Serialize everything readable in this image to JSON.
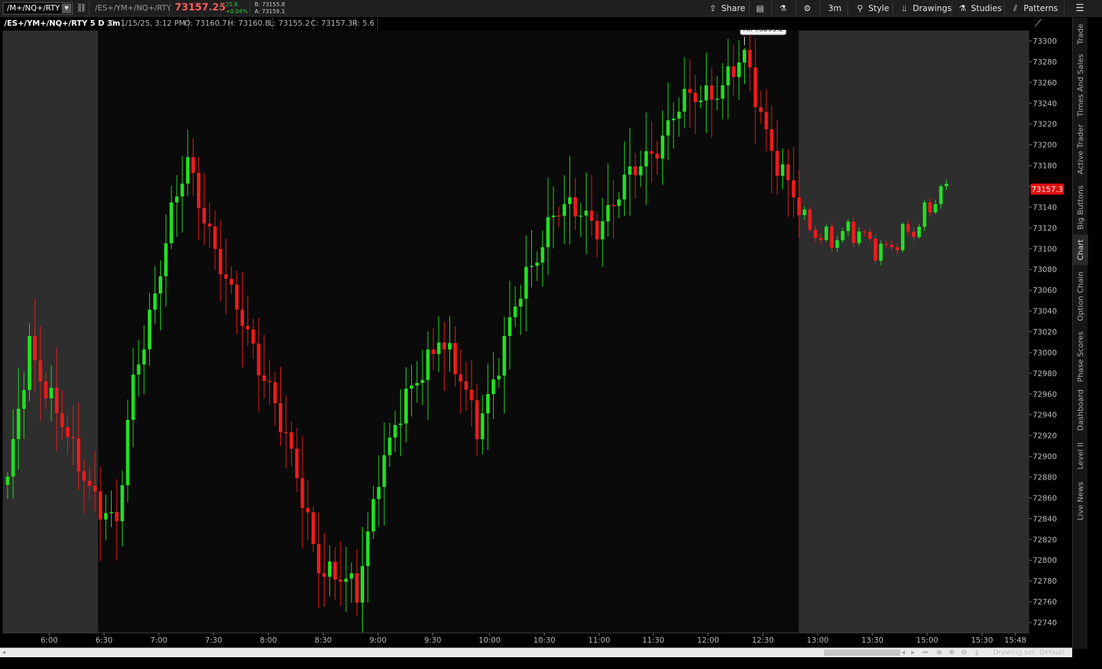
{
  "toolbar": {
    "symbol_input": "/M+/NQ+/RTY",
    "full_symbol": "/ES+/YM+/NQ+/RTY",
    "last_price": "73157.25",
    "net_change": "25.8",
    "percent_change": "+0.04%",
    "bid": "B: 73155.8",
    "ask": "A: 73159.1",
    "share_label": "Share",
    "timeframe_label": "3m",
    "style_label": "Style",
    "drawings_label": "Drawings",
    "studies_label": "Studies",
    "patterns_label": "Patterns"
  },
  "info_bar": {
    "title": "/ES+/YM+/NQ+/RTY 5 D 3m",
    "date": "D: 1/15/25, 3:12 PM",
    "open": "O: 73160.7",
    "high": "H: 73160.8",
    "low": "L: 73155.2",
    "close": "C: 73157.3",
    "range": "R: 5.6"
  },
  "sidebar": {
    "tabs": [
      "Trade",
      "Times And Sales",
      "Active Trader",
      "Big Buttons",
      "Chart",
      "Option Chain",
      "Phase Scores",
      "Dashboard",
      "Level II",
      "Live News"
    ],
    "active": "Chart"
  },
  "bottom_bar": {
    "drawing_set_label": "Drawing set: Default"
  },
  "colors": {
    "up": "#22e022",
    "down": "#ee1b1b",
    "session_bg": "#0a0a0a",
    "extended_bg": "#2e2e2e",
    "price_tag_bg": "#e01010"
  },
  "chart_data": {
    "type": "candlestick",
    "x_ticks": [
      "6:00",
      "6:30",
      "7:00",
      "7:30",
      "8:00",
      "8:30",
      "9:00",
      "9:30",
      "10:00",
      "10:30",
      "11:00",
      "11:30",
      "12:00",
      "12:30",
      "13:00",
      "13:30",
      "15:00",
      "15:30",
      "15:48"
    ],
    "y_ticks": [
      73300,
      73280,
      73260,
      73240,
      73220,
      73200,
      73180,
      73160,
      73140,
      73120,
      73100,
      73080,
      73060,
      73040,
      73020,
      73000,
      72980,
      72960,
      72940,
      72920,
      72900,
      72880,
      72860,
      72840,
      72820,
      72800,
      72780,
      72760,
      72740
    ],
    "y_range": [
      72730,
      73310
    ],
    "current_price_label": "73157.3",
    "current_price": 73157.3,
    "high_marker_label": "Hi: 73293.2",
    "high_marker": 73293.2,
    "candle_count": 174,
    "regular_session_candles": [
      17,
      145
    ],
    "ohlc_key_points": [
      {
        "i": 0,
        "close": 72870
      },
      {
        "i": 4,
        "close": 73010
      },
      {
        "i": 12,
        "close": 72900
      },
      {
        "i": 20,
        "close": 72830
      },
      {
        "i": 23,
        "close": 72970
      },
      {
        "i": 30,
        "close": 73130
      },
      {
        "i": 33,
        "close": 73180
      },
      {
        "i": 37,
        "close": 73120
      },
      {
        "i": 41,
        "close": 73050
      },
      {
        "i": 48,
        "close": 72970
      },
      {
        "i": 57,
        "close": 72800
      },
      {
        "i": 64,
        "close": 72765
      },
      {
        "i": 68,
        "close": 72890
      },
      {
        "i": 79,
        "close": 73020
      },
      {
        "i": 86,
        "close": 72930
      },
      {
        "i": 93,
        "close": 73040
      },
      {
        "i": 100,
        "close": 73140
      },
      {
        "i": 108,
        "close": 73125
      },
      {
        "i": 116,
        "close": 73180
      },
      {
        "i": 123,
        "close": 73235
      },
      {
        "i": 131,
        "close": 73260
      },
      {
        "i": 135,
        "close": 73280
      },
      {
        "i": 140,
        "close": 73200
      },
      {
        "i": 146,
        "close": 73120
      },
      {
        "i": 160,
        "close": 73105
      },
      {
        "i": 166,
        "close": 73110
      },
      {
        "i": 170,
        "close": 73155
      },
      {
        "i": 171,
        "close": 73165
      },
      {
        "i": 172,
        "close": 73157.3
      }
    ]
  }
}
